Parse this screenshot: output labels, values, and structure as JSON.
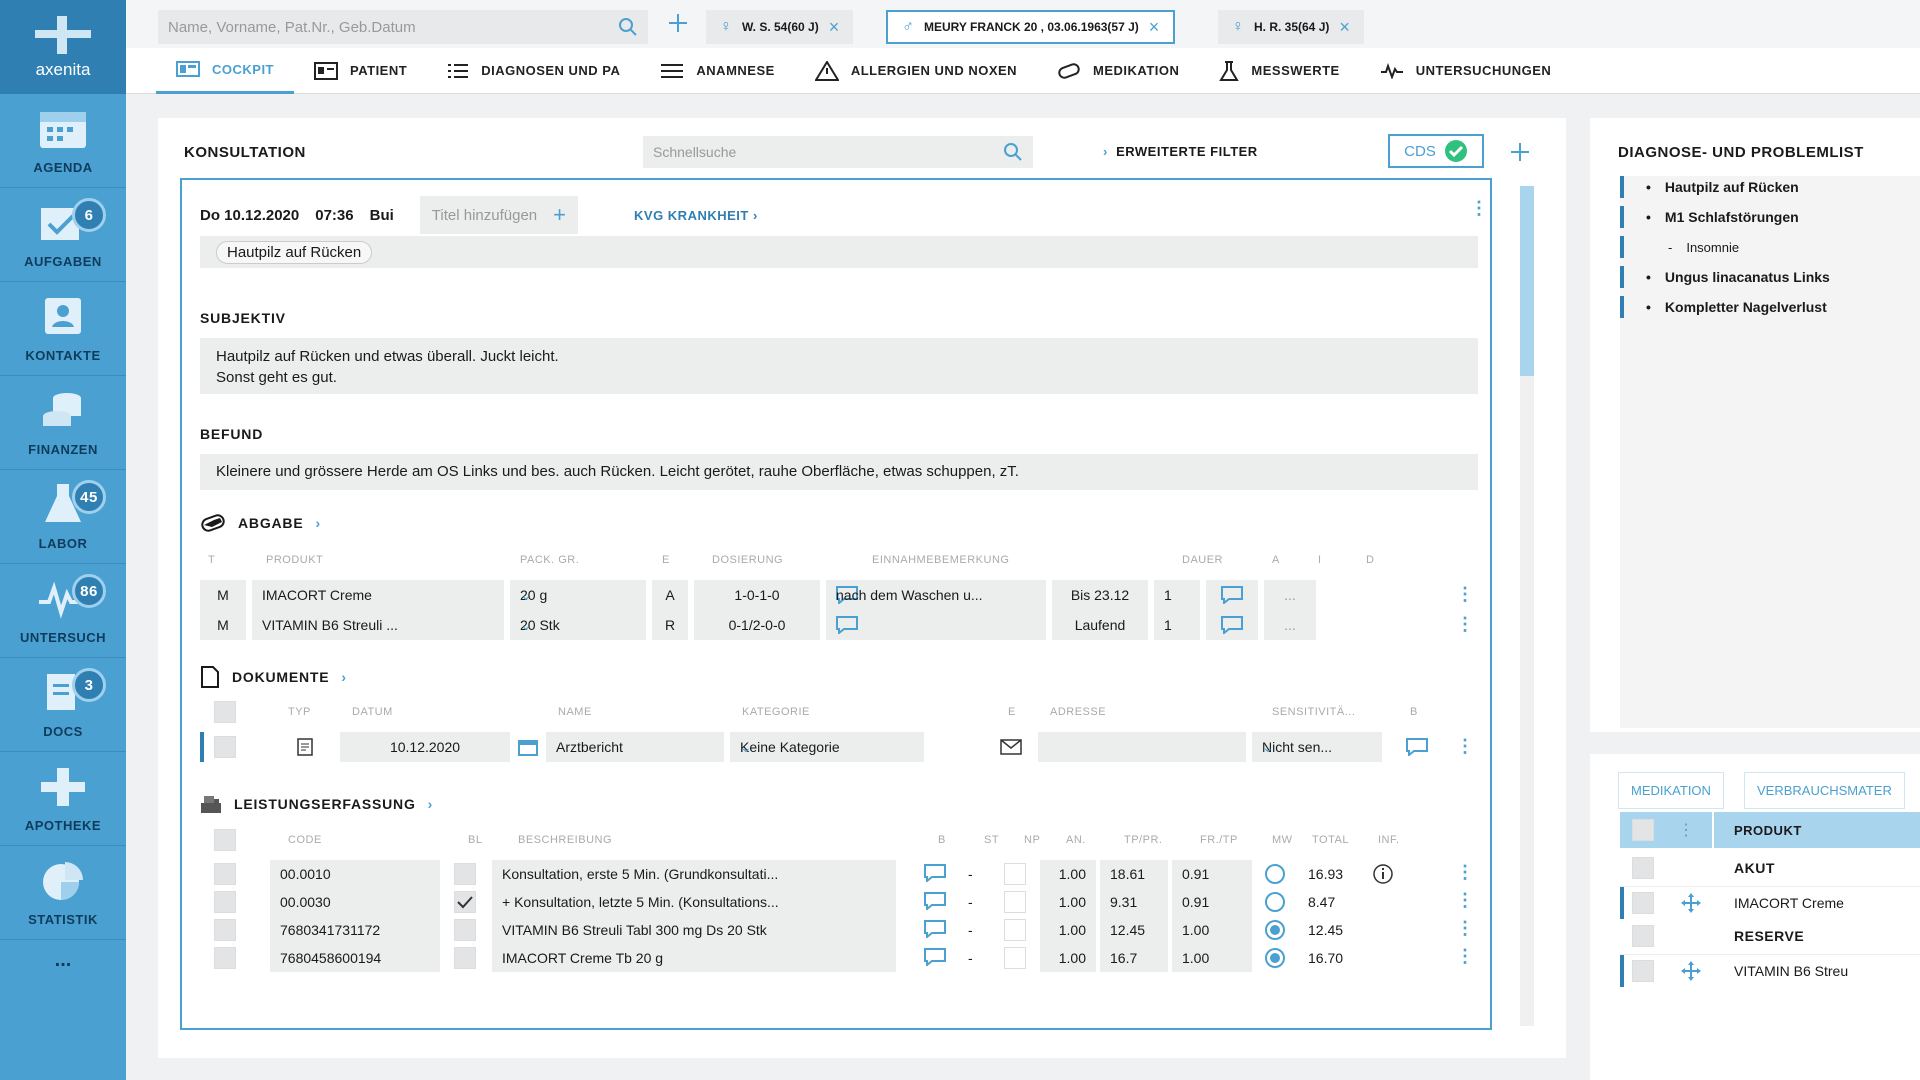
{
  "sidebar": {
    "logo": "axenita",
    "items": [
      {
        "label": "AGENDA",
        "icon": "calendar-icon",
        "badge": ""
      },
      {
        "label": "AUFGABEN",
        "icon": "tasks-icon",
        "badge": "6"
      },
      {
        "label": "KONTAKTE",
        "icon": "contacts-icon",
        "badge": ""
      },
      {
        "label": "FINANZEN",
        "icon": "coins-icon",
        "badge": ""
      },
      {
        "label": "LABOR",
        "icon": "flask-icon",
        "badge": "45"
      },
      {
        "label": "UNTERSUCH",
        "icon": "pulse-icon",
        "badge": "86"
      },
      {
        "label": "DOCS",
        "icon": "documents-icon",
        "badge": "3"
      },
      {
        "label": "APOTHEKE",
        "icon": "pharmacy-cross-icon",
        "badge": ""
      },
      {
        "label": "STATISTIK",
        "icon": "pie-chart-icon",
        "badge": ""
      }
    ],
    "more": "..."
  },
  "topbar": {
    "search_placeholder": "Name, Vorname, Pat.Nr., Geb.Datum",
    "patient_tabs": [
      {
        "label": "W. S. 54(60 J)",
        "gender": "female"
      },
      {
        "label": "MEURY FRANCK 20 , 03.06.1963(57 J)",
        "gender": "male",
        "active": true
      },
      {
        "label": "H. R. 35(64 J)",
        "gender": "female"
      }
    ]
  },
  "nav_tabs": [
    {
      "label": "COCKPIT",
      "icon": "dashboard-icon",
      "active": true
    },
    {
      "label": "PATIENT",
      "icon": "id-card-icon"
    },
    {
      "label": "DIAGNOSEN UND PA",
      "icon": "list-icon"
    },
    {
      "label": "ANAMNESE",
      "icon": "checklist-icon"
    },
    {
      "label": "ALLERGIEN UND NOXEN",
      "icon": "warning-icon"
    },
    {
      "label": "MEDIKATION",
      "icon": "pill-icon"
    },
    {
      "label": "MESSWERTE",
      "icon": "beaker-icon"
    },
    {
      "label": "UNTERSUCHUNGEN",
      "icon": "pulse-icon"
    }
  ],
  "konsultation": {
    "title": "KONSULTATION",
    "quick_search_placeholder": "Schnellsuche",
    "filter_label": "ERWEITERTE FILTER",
    "cds_label": "CDS",
    "entry": {
      "date": "Do 10.12.2020",
      "time": "07:36",
      "user": "Bui",
      "title_placeholder": "Titel hinzufügen",
      "case": "KVG KRANKHEIT",
      "tag": "Hautpilz auf Rücken"
    },
    "subjektiv": {
      "title": "SUBJEKTIV",
      "line1": "Hautpilz auf Rücken und etwas überall. Juckt leicht.",
      "line2": "Sonst geht es gut."
    },
    "befund": {
      "title": "BEFUND",
      "text": "Kleinere und grössere Herde am OS Links und bes. auch Rücken. Leicht gerötet, rauhe Oberfläche, etwas schuppen, zT."
    },
    "abgabe": {
      "title": "ABGABE",
      "columns": [
        "T",
        "PRODUKT",
        "PACK. GR.",
        "E",
        "DOSIERUNG",
        "EINNAHMEBEMERKUNG",
        "DAUER",
        "A",
        "I",
        "D"
      ],
      "rows": [
        {
          "t": "M",
          "produkt": "IMACORT Creme",
          "pack": "20 g",
          "e": "A",
          "dosierung": "1-0-1-0",
          "bemerkung": "nach dem Waschen u...",
          "dauer": "Bis 23.12",
          "a": "1",
          "d": "..."
        },
        {
          "t": "M",
          "produkt": "VITAMIN B6 Streuli ...",
          "pack": "20 Stk",
          "e": "R",
          "dosierung": "0-1/2-0-0",
          "bemerkung": "",
          "dauer": "Laufend",
          "a": "1",
          "d": "..."
        }
      ]
    },
    "dokumente": {
      "title": "DOKUMENTE",
      "columns": [
        "TYP",
        "DATUM",
        "NAME",
        "KATEGORIE",
        "E",
        "ADRESSE",
        "SENSITIVITÄ...",
        "B"
      ],
      "rows": [
        {
          "datum": "10.12.2020",
          "name": "Arztbericht",
          "kategorie": "Keine Kategorie",
          "adresse": "",
          "sensitivitaet": "Nicht sen..."
        }
      ]
    },
    "leistungen": {
      "title": "LEISTUNGSERFASSUNG",
      "columns": [
        "CODE",
        "BL",
        "BESCHREIBUNG",
        "B",
        "ST",
        "NP",
        "AN.",
        "TP/PR.",
        "FR./TP",
        "MW",
        "TOTAL",
        "INF."
      ],
      "rows": [
        {
          "code": "00.0010",
          "bl": false,
          "beschreibung": "Konsultation, erste 5 Min. (Grundkonsultati...",
          "st": "-",
          "an": "1.00",
          "tp": "18.61",
          "fr": "0.91",
          "total": "16.93",
          "mw_filled": false,
          "info": true
        },
        {
          "code": "00.0030",
          "bl": true,
          "beschreibung": "+ Konsultation, letzte 5 Min. (Konsultations...",
          "st": "-",
          "an": "1.00",
          "tp": "9.31",
          "fr": "0.91",
          "total": "8.47",
          "mw_filled": false,
          "info": false
        },
        {
          "code": "7680341731172",
          "bl": false,
          "beschreibung": "VITAMIN B6 Streuli Tabl 300 mg Ds 20 Stk",
          "st": "-",
          "an": "1.00",
          "tp": "12.45",
          "fr": "1.00",
          "total": "12.45",
          "mw_filled": true,
          "info": false
        },
        {
          "code": "7680458600194",
          "bl": false,
          "beschreibung": "IMACORT Creme Tb 20 g",
          "st": "-",
          "an": "1.00",
          "tp": "16.7",
          "fr": "1.00",
          "total": "16.70",
          "mw_filled": true,
          "info": false
        }
      ]
    }
  },
  "problems": {
    "title": "DIAGNOSE- UND PROBLEMLIST",
    "items": [
      {
        "label": "Hautpilz auf Rücken",
        "sub": false
      },
      {
        "label": "M1 Schlafstörungen",
        "sub": false
      },
      {
        "label": "Insomnie",
        "sub": true
      },
      {
        "label": "Ungus linacanatus Links",
        "sub": false
      },
      {
        "label": "Kompletter Nagelverlust",
        "sub": false
      }
    ]
  },
  "medication_panel": {
    "tabs": [
      "MEDIKATION",
      "VERBRAUCHSMATER"
    ],
    "header": "PRODUKT",
    "groups": [
      {
        "label": "AKUT",
        "items": [
          "IMACORT Creme"
        ]
      },
      {
        "label": "RESERVE",
        "items": [
          "VITAMIN B6 Streu"
        ]
      }
    ]
  }
}
